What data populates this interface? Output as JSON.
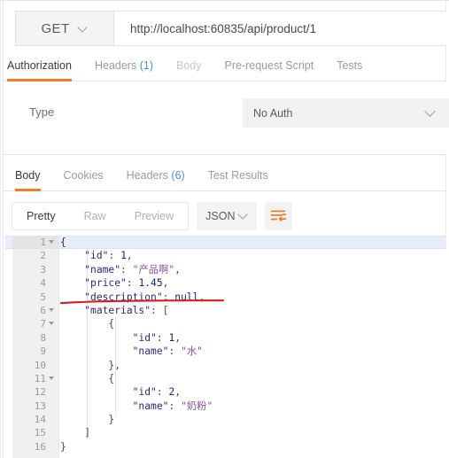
{
  "request": {
    "method": "GET",
    "method_icon": "chevron-down-icon",
    "url": "http://localhost:60835/api/product/1",
    "url_placeholder": "Enter request URL"
  },
  "request_tabs": [
    {
      "label": "Authorization",
      "count": "",
      "active": true
    },
    {
      "label": "Headers",
      "count": "(1)",
      "active": false
    },
    {
      "label": "Body",
      "count": "",
      "active": false,
      "dim": true
    },
    {
      "label": "Pre-request Script",
      "count": "",
      "active": false
    },
    {
      "label": "Tests",
      "count": "",
      "active": false
    }
  ],
  "auth": {
    "type_label": "Type",
    "selected": "No Auth",
    "chevron_icon": "chevron-down-icon"
  },
  "response_tabs": [
    {
      "label": "Body",
      "count": "",
      "active": true
    },
    {
      "label": "Cookies",
      "count": "",
      "active": false
    },
    {
      "label": "Headers",
      "count": "(6)",
      "active": false
    },
    {
      "label": "Test Results",
      "count": "",
      "active": false
    }
  ],
  "format_bar": {
    "views": [
      {
        "label": "Pretty",
        "active": true
      },
      {
        "label": "Raw",
        "active": false
      },
      {
        "label": "Preview",
        "active": false
      }
    ],
    "language": "JSON",
    "language_chevron_icon": "chevron-down-icon",
    "wrap_button_icon": "text-wrap-icon",
    "wrap_button_color": "#ef7d28"
  },
  "annotation": {
    "type": "red-underline",
    "color": "#d02020",
    "targets_line": 5,
    "targets_text": "\"description\": null,"
  },
  "code": {
    "active_line": 1,
    "language": "json",
    "lines": [
      {
        "num": "1",
        "fold": true,
        "indent": 0,
        "html": "{"
      },
      {
        "num": "2",
        "fold": false,
        "indent": 1,
        "html": "    <span class=\"k\">\"id\"</span><span class=\"p\">:</span> <span class=\"n\">1</span><span class=\"p\">,</span>"
      },
      {
        "num": "3",
        "fold": false,
        "indent": 1,
        "html": "    <span class=\"k\">\"name\"</span><span class=\"p\">:</span> <span class=\"s\">\"产品啊\"</span><span class=\"p\">,</span>"
      },
      {
        "num": "4",
        "fold": false,
        "indent": 1,
        "html": "    <span class=\"k\">\"price\"</span><span class=\"p\">:</span> <span class=\"n\">1.45</span><span class=\"p\">,</span>"
      },
      {
        "num": "5",
        "fold": false,
        "indent": 1,
        "html": "    <span class=\"k\">\"description\"</span><span class=\"p\">:</span> <span class=\"nul\">null</span><span class=\"p\">,</span>"
      },
      {
        "num": "6",
        "fold": true,
        "indent": 1,
        "html": "    <span class=\"k\">\"materials\"</span><span class=\"p\">:</span> <span class=\"p\">[</span>"
      },
      {
        "num": "7",
        "fold": true,
        "indent": 2,
        "html": "        <span class=\"p\">{</span>"
      },
      {
        "num": "8",
        "fold": false,
        "indent": 3,
        "html": "            <span class=\"k\">\"id\"</span><span class=\"p\">:</span> <span class=\"n\">1</span><span class=\"p\">,</span>"
      },
      {
        "num": "9",
        "fold": false,
        "indent": 3,
        "html": "            <span class=\"k\">\"name\"</span><span class=\"p\">:</span> <span class=\"s\">\"水\"</span>"
      },
      {
        "num": "10",
        "fold": false,
        "indent": 2,
        "html": "        <span class=\"p\">},</span>"
      },
      {
        "num": "11",
        "fold": true,
        "indent": 2,
        "html": "        <span class=\"p\">{</span>"
      },
      {
        "num": "12",
        "fold": false,
        "indent": 3,
        "html": "            <span class=\"k\">\"id\"</span><span class=\"p\">:</span> <span class=\"n\">2</span><span class=\"p\">,</span>"
      },
      {
        "num": "13",
        "fold": false,
        "indent": 3,
        "html": "            <span class=\"k\">\"name\"</span><span class=\"p\">:</span> <span class=\"s\">\"奶粉\"</span>"
      },
      {
        "num": "14",
        "fold": false,
        "indent": 2,
        "html": "        <span class=\"p\">}</span>"
      },
      {
        "num": "15",
        "fold": false,
        "indent": 1,
        "html": "    <span class=\"p\">]</span>"
      },
      {
        "num": "16",
        "fold": false,
        "indent": 0,
        "html": "<span class=\"p\">}</span>"
      }
    ]
  },
  "colors": {
    "accent_orange": "#ef7d28",
    "link_blue": "#4e8fd6",
    "json_key": "#2b2b7e",
    "json_string": "#8a4f9e",
    "json_number": "#1c1c9c",
    "active_line_bg": "#e7eefa",
    "annotation_red": "#d02020"
  }
}
